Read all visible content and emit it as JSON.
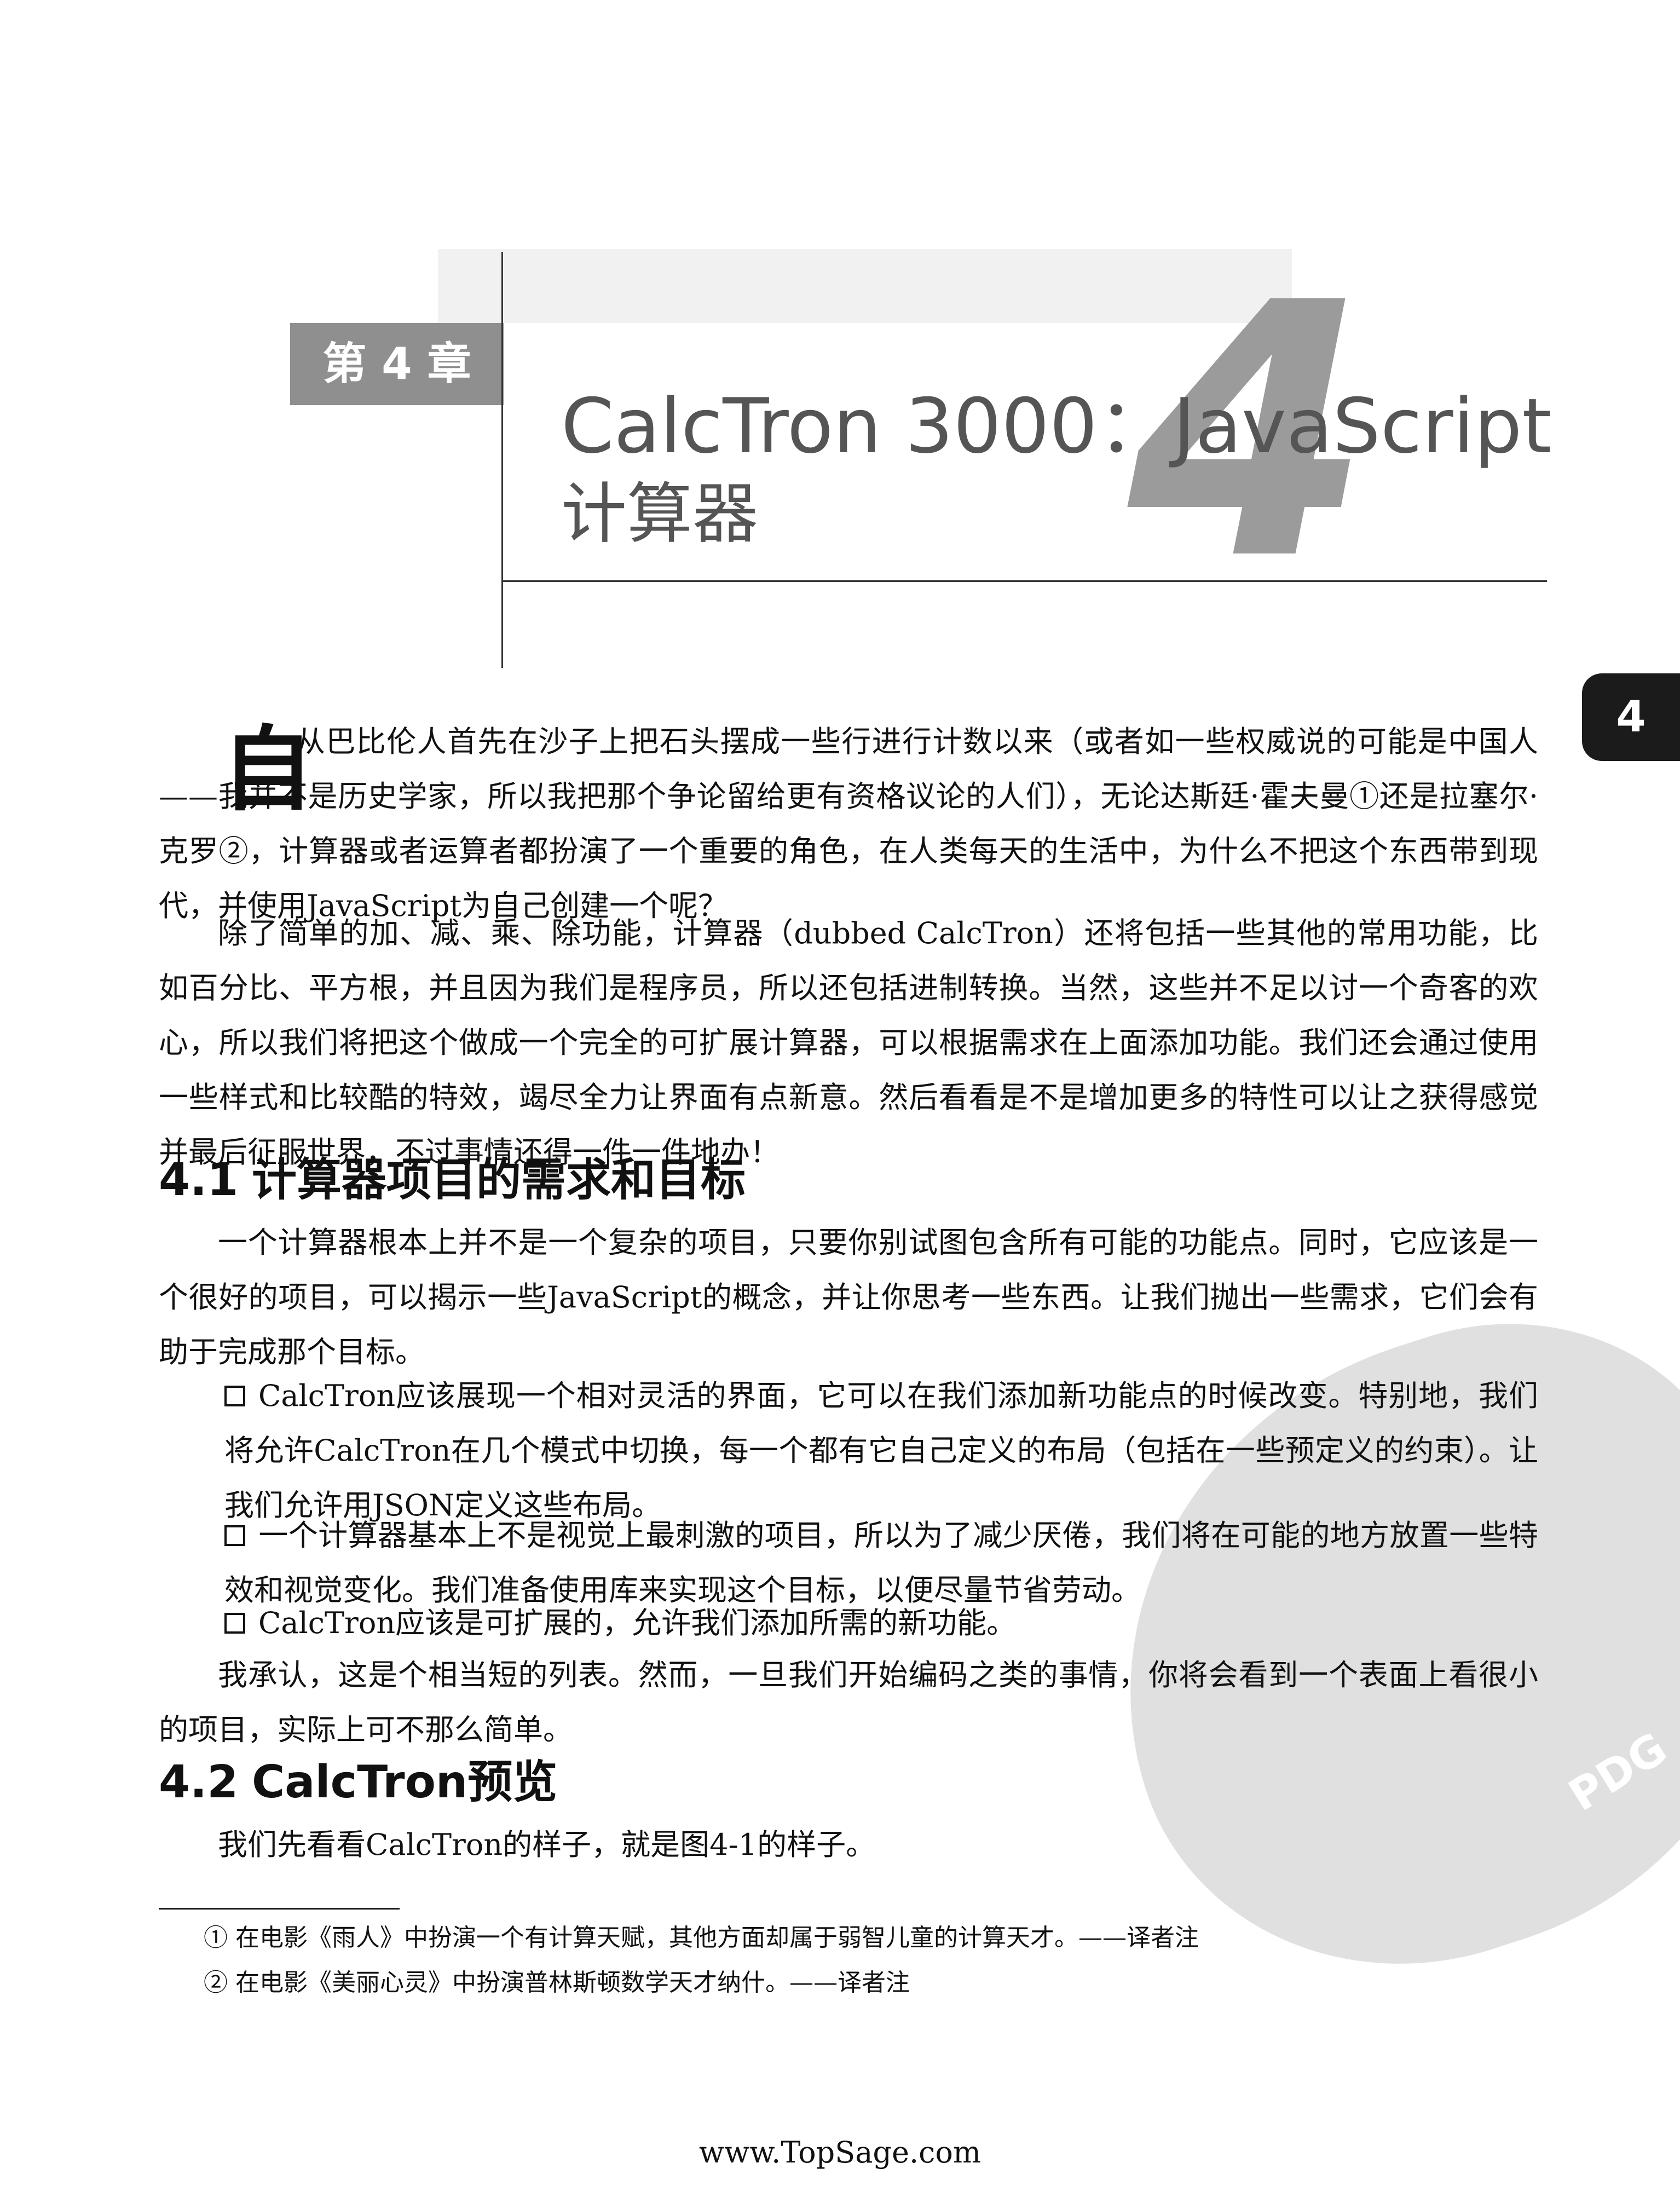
{
  "chapter": {
    "label": "第 4 章",
    "big_number": "4",
    "title_line1": "CalcTron 3000：JavaScript",
    "title_line2": "计算器"
  },
  "side_tab": {
    "label": "4"
  },
  "intro": {
    "drop_cap": "自",
    "p1": "从巴比伦人首先在沙子上把石头摆成一些行进行计数以来（或者如一些权威说的可能是中国人——我并不是历史学家，所以我把那个争论留给更有资格议论的人们），无论达斯廷·霍夫曼①还是拉塞尔·克罗②，计算器或者运算者都扮演了一个重要的角色，在人类每天的生活中，为什么不把这个东西带到现代，并使用JavaScript为自己创建一个呢？",
    "p2": "除了简单的加、减、乘、除功能，计算器（dubbed CalcTron）还将包括一些其他的常用功能，比如百分比、平方根，并且因为我们是程序员，所以还包括进制转换。当然，这些并不足以讨一个奇客的欢心，所以我们将把这个做成一个完全的可扩展计算器，可以根据需求在上面添加功能。我们还会通过使用一些样式和比较酷的特效，竭尽全力让界面有点新意。然后看看是不是增加更多的特性可以让之获得感觉并最后征服世界，不过事情还得一件一件地办！"
  },
  "section1": {
    "number": "4.1",
    "title": "计算器项目的需求和目标",
    "p1": "一个计算器根本上并不是一个复杂的项目，只要你别试图包含所有可能的功能点。同时，它应该是一个很好的项目，可以揭示一些JavaScript的概念，并让你思考一些东西。让我们抛出一些需求，它们会有助于完成那个目标。",
    "bullets": [
      "CalcTron应该展现一个相对灵活的界面，它可以在我们添加新功能点的时候改变。特别地，我们将允许CalcTron在几个模式中切换，每一个都有它自己定义的布局（包括在一些预定义的约束）。让我们允许用JSON定义这些布局。",
      "一个计算器基本上不是视觉上最刺激的项目，所以为了减少厌倦，我们将在可能的地方放置一些特效和视觉变化。我们准备使用库来实现这个目标，以便尽量节省劳动。",
      "CalcTron应该是可扩展的，允许我们添加所需的新功能。"
    ],
    "p2": "我承认，这是个相当短的列表。然而，一旦我们开始编码之类的事情，你将会看到一个表面上看很小的项目，实际上可不那么简单。"
  },
  "section2": {
    "number": "4.2",
    "title": "CalcTron预览",
    "p1": "我们先看看CalcTron的样子，就是图4-1的样子。"
  },
  "footnotes": [
    "① 在电影《雨人》中扮演一个有计算天赋，其他方面却属于弱智儿童的计算天才。——译者注",
    "② 在电影《美丽心灵》中扮演普林斯顿数学天才纳什。——译者注"
  ],
  "watermark": {
    "text": "PDG"
  },
  "footer": {
    "url": "www.TopSage.com"
  }
}
